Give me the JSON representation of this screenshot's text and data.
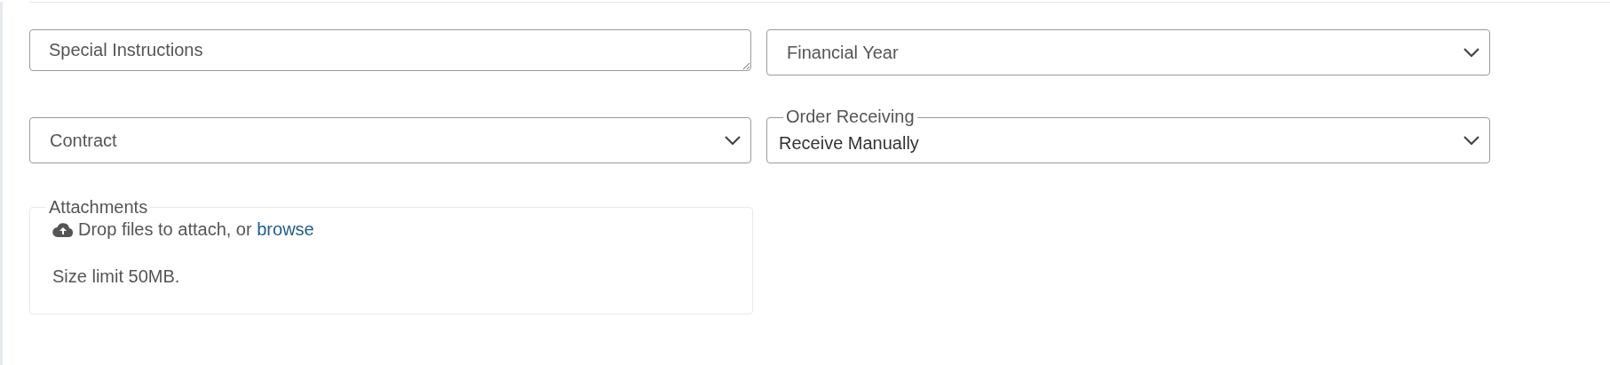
{
  "rows": [
    {
      "fields": [
        {
          "kind": "textarea",
          "placeholder": "Special Instructions"
        },
        {
          "kind": "select",
          "placeholder": "Financial Year"
        }
      ]
    },
    {
      "fields": [
        {
          "kind": "select",
          "placeholder": "Contract"
        },
        {
          "kind": "select",
          "label": "Order Receiving",
          "value": "Receive Manually"
        }
      ]
    }
  ],
  "attachments": {
    "label": "Attachments",
    "prompt": "Drop files to attach, or",
    "link": "browse",
    "note": "Size limit 50MB."
  }
}
